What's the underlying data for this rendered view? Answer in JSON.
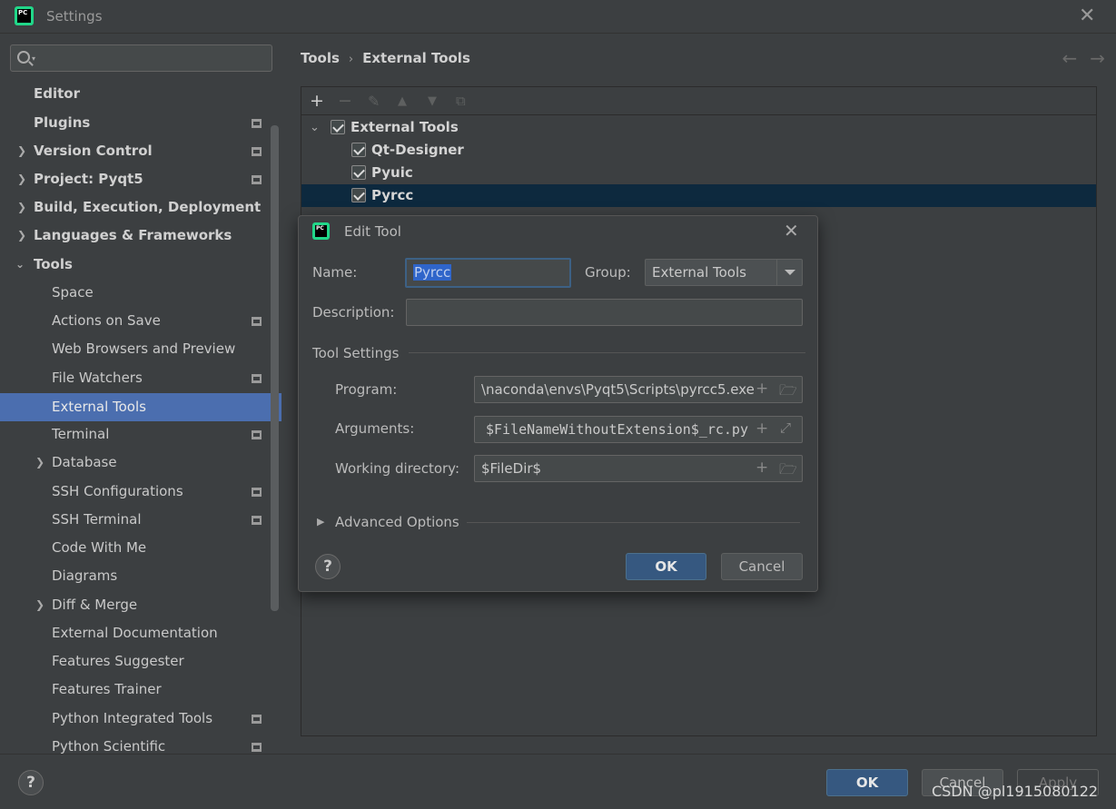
{
  "window": {
    "title": "Settings",
    "logo_text": "PC"
  },
  "sidebar": {
    "items": [
      {
        "label": "Editor"
      },
      {
        "label": "Plugins"
      },
      {
        "label": "Version Control"
      },
      {
        "label": "Project: Pyqt5"
      },
      {
        "label": "Build, Execution, Deployment"
      },
      {
        "label": "Languages & Frameworks"
      },
      {
        "label": "Tools"
      },
      {
        "label": "Space"
      },
      {
        "label": "Actions on Save"
      },
      {
        "label": "Web Browsers and Preview"
      },
      {
        "label": "File Watchers"
      },
      {
        "label": "External Tools"
      },
      {
        "label": "Terminal"
      },
      {
        "label": "Database"
      },
      {
        "label": "SSH Configurations"
      },
      {
        "label": "SSH Terminal"
      },
      {
        "label": "Code With Me"
      },
      {
        "label": "Diagrams"
      },
      {
        "label": "Diff & Merge"
      },
      {
        "label": "External Documentation"
      },
      {
        "label": "Features Suggester"
      },
      {
        "label": "Features Trainer"
      },
      {
        "label": "Python Integrated Tools"
      },
      {
        "label": "Python Scientific"
      }
    ]
  },
  "breadcrumb": {
    "parent": "Tools",
    "current": "External Tools"
  },
  "tools_tree": {
    "group": "External Tools",
    "items": [
      "Qt-Designer",
      "Pyuic",
      "Pyrcc"
    ]
  },
  "dialog": {
    "title": "Edit Tool",
    "name_label": "Name:",
    "name_value": "Pyrcc",
    "group_label": "Group:",
    "group_value": "External Tools",
    "description_label": "Description:",
    "description_value": "",
    "tool_settings_title": "Tool Settings",
    "program_label": "Program:",
    "program_value": "\\naconda\\envs\\Pyqt5\\Scripts\\pyrcc5.exe",
    "arguments_label": "Arguments:",
    "arguments_value": "$FileNameWithoutExtension$_rc.py",
    "working_dir_label": "Working directory:",
    "working_dir_value": "$FileDir$",
    "advanced_label": "Advanced Options",
    "ok_label": "OK",
    "cancel_label": "Cancel",
    "help_label": "?"
  },
  "footer": {
    "help_label": "?",
    "ok_label": "OK",
    "cancel_label": "Cancel",
    "apply_label": "Apply"
  },
  "watermark": "CSDN @pl1915080122",
  "colors": {
    "background": "#3c3f41",
    "selection": "#4b6eaf",
    "primary_button": "#365880",
    "tree_selection": "#0d293e",
    "pycharm_green": "#21d789"
  }
}
